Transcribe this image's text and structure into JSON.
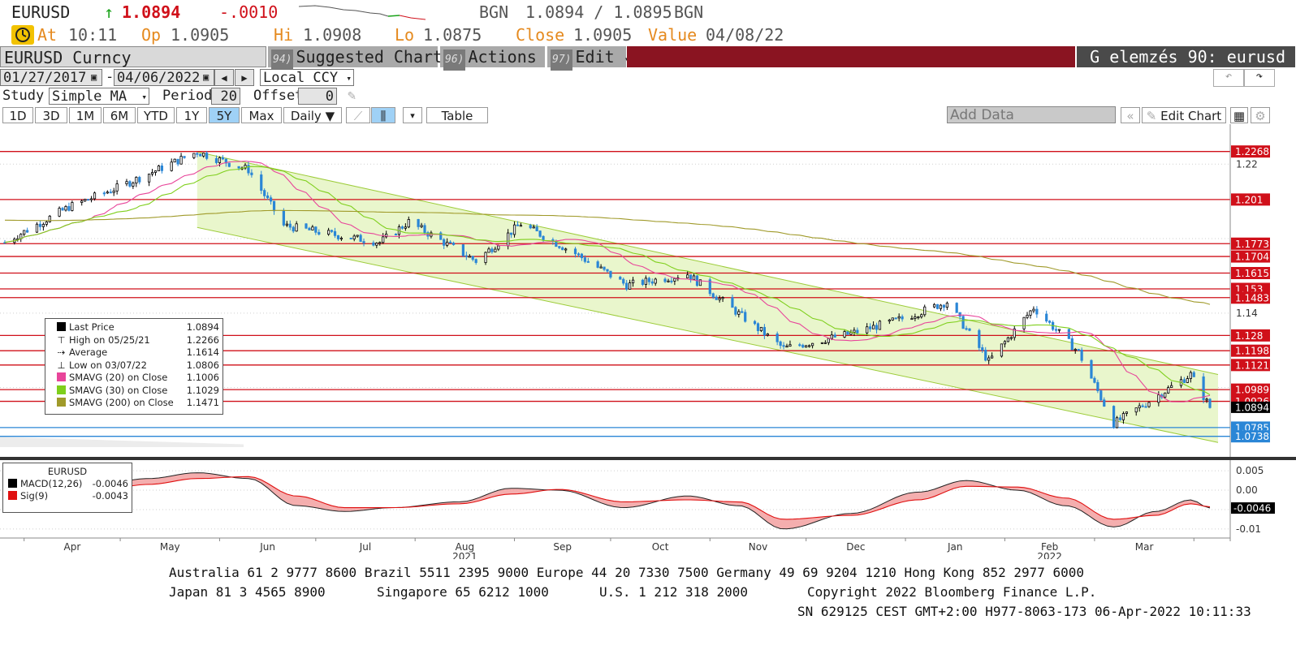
{
  "quote": {
    "ticker": "EURUSD",
    "last": "1.0894",
    "change": "-.0010",
    "source_left": "BGN",
    "bid_ask": "1.0894 / 1.0895",
    "source_right": "BGN",
    "at_label": "At",
    "at_time": "10:11",
    "open_label": "Op",
    "open": "1.0905",
    "high_label": "Hi",
    "high": "1.0908",
    "low_label": "Lo",
    "low": "1.0875",
    "close_label": "Close",
    "close": "1.0905",
    "value_label": "Value",
    "value_date": "04/08/22"
  },
  "menubar": {
    "security": "EURUSD Curncy",
    "suggested_num": "94)",
    "suggested": "Suggested Charts",
    "actions_num": "96)",
    "actions": "Actions",
    "edit_num": "97)",
    "edit": "Edit",
    "function_title": "G elemzés 90: eurusd"
  },
  "controls": {
    "date_from": "01/27/2017",
    "date_sep": "-",
    "date_to": "04/06/2022",
    "currency": "Local CCY",
    "study_label": "Study",
    "study": "Simple MA",
    "period_label": "Period",
    "period": "20",
    "offset_label": "Offset",
    "offset": "0"
  },
  "tabs": [
    "1D",
    "3D",
    "1M",
    "6M",
    "YTD",
    "1Y",
    "5Y",
    "Max"
  ],
  "selected_tab": "5Y",
  "frequency": "Daily",
  "table_label": "Table",
  "add_data_placeholder": "Add Data",
  "edit_chart": "Edit Chart",
  "legend": {
    "rows": [
      {
        "label": "Last Price",
        "value": "1.0894",
        "color": "#000000"
      },
      {
        "label": "High on 05/25/21",
        "value": "1.2266",
        "color": ""
      },
      {
        "label": "Average",
        "value": "1.1614",
        "color": ""
      },
      {
        "label": "Low on 03/07/22",
        "value": "1.0806",
        "color": ""
      },
      {
        "label": "SMAVG (20)  on Close",
        "value": "1.1006",
        "color": "#e8459a"
      },
      {
        "label": "SMAVG (30)  on Close",
        "value": "1.1029",
        "color": "#7fcf1c"
      },
      {
        "label": "SMAVG (200)  on Close",
        "value": "1.1471",
        "color": "#a09a2a"
      }
    ]
  },
  "macd_legend": {
    "title": "EURUSD",
    "rows": [
      {
        "label": "MACD(12,26)",
        "value": "-0.0046",
        "color": "#000000"
      },
      {
        "label": "Sig(9)",
        "value": "-0.0043",
        "color": "#e01010"
      }
    ]
  },
  "chart_data": [
    {
      "type": "candlestick",
      "title": "EURUSD Curncy",
      "ylim": [
        1.068,
        1.238
      ],
      "yticks": [
        "1.22",
        "1.14"
      ],
      "x_months": [
        "Apr",
        "May",
        "Jun",
        "Jul",
        "Aug",
        "Sep",
        "Oct",
        "Nov",
        "Dec",
        "Jan",
        "Feb",
        "Mar"
      ],
      "year_labels": [
        "2021",
        "2022"
      ],
      "approx_close_path": [
        {
          "date": "2021-03-26",
          "close": 1.178
        },
        {
          "date": "2021-04-15",
          "close": 1.197
        },
        {
          "date": "2021-05-01",
          "close": 1.208
        },
        {
          "date": "2021-05-25",
          "close": 1.2266
        },
        {
          "date": "2021-06-10",
          "close": 1.217
        },
        {
          "date": "2021-06-21",
          "close": 1.187
        },
        {
          "date": "2021-07-07",
          "close": 1.182
        },
        {
          "date": "2021-07-21",
          "close": 1.178
        },
        {
          "date": "2021-07-30",
          "close": 1.189
        },
        {
          "date": "2021-08-20",
          "close": 1.168
        },
        {
          "date": "2021-09-03",
          "close": 1.188
        },
        {
          "date": "2021-09-20",
          "close": 1.172
        },
        {
          "date": "2021-10-06",
          "close": 1.155
        },
        {
          "date": "2021-10-25",
          "close": 1.161
        },
        {
          "date": "2021-11-24",
          "close": 1.121
        },
        {
          "date": "2021-12-15",
          "close": 1.129
        },
        {
          "date": "2021-12-31",
          "close": 1.137
        },
        {
          "date": "2022-01-14",
          "close": 1.146
        },
        {
          "date": "2022-01-27",
          "close": 1.114
        },
        {
          "date": "2022-02-10",
          "close": 1.143
        },
        {
          "date": "2022-02-24",
          "close": 1.119
        },
        {
          "date": "2022-03-07",
          "close": 1.0806
        },
        {
          "date": "2022-03-31",
          "close": 1.107
        },
        {
          "date": "2022-04-06",
          "close": 1.0894
        }
      ],
      "horizontal_levels": [
        {
          "label": "1.2268",
          "value": 1.2268,
          "color": "#d0101a"
        },
        {
          "label": "1.201",
          "value": 1.201,
          "color": "#d0101a"
        },
        {
          "label": "1.1773",
          "value": 1.1773,
          "color": "#d0101a"
        },
        {
          "label": "1.1704",
          "value": 1.1704,
          "color": "#d0101a"
        },
        {
          "label": "1.1615",
          "value": 1.1615,
          "color": "#d0101a"
        },
        {
          "label": "1.153",
          "value": 1.153,
          "color": "#d0101a"
        },
        {
          "label": "1.1483",
          "value": 1.1483,
          "color": "#d0101a"
        },
        {
          "label": "1.128",
          "value": 1.128,
          "color": "#d0101a"
        },
        {
          "label": "1.1198",
          "value": 1.1198,
          "color": "#d0101a"
        },
        {
          "label": "1.1121",
          "value": 1.1121,
          "color": "#d0101a"
        },
        {
          "label": "1.0989",
          "value": 1.0989,
          "color": "#d0101a"
        },
        {
          "label": "1.0926",
          "value": 1.0926,
          "color": "#d0101a"
        },
        {
          "label": "1.0785",
          "value": 1.0785,
          "color": "#2a86d6"
        },
        {
          "label": "1.0738",
          "value": 1.0738,
          "color": "#2a86d6"
        }
      ],
      "last_price_tag": "1.0894",
      "colors": {
        "up": "#000000",
        "down": "#2a86d6",
        "channel": "#e9f6cc",
        "sma20": "#e8459a",
        "sma30": "#7fcf1c",
        "sma200": "#a09a2a",
        "level": "#d0101a"
      }
    },
    {
      "type": "line",
      "title": "EURUSD",
      "ylim": [
        -0.0115,
        0.0065
      ],
      "yticks": [
        "0.005",
        "0.00",
        "-0.005",
        "-0.01"
      ],
      "last_tag": "-0.0046",
      "series": [
        {
          "name": "MACD(12,26)",
          "points": [
            {
              "date": "2021-03-26",
              "y": -0.0055
            },
            {
              "date": "2021-04-15",
              "y": -0.0005
            },
            {
              "date": "2021-05-10",
              "y": 0.003
            },
            {
              "date": "2021-05-25",
              "y": 0.0045
            },
            {
              "date": "2021-06-10",
              "y": 0.003
            },
            {
              "date": "2021-06-25",
              "y": -0.004
            },
            {
              "date": "2021-07-10",
              "y": -0.0055
            },
            {
              "date": "2021-07-25",
              "y": -0.0045
            },
            {
              "date": "2021-08-15",
              "y": -0.003
            },
            {
              "date": "2021-08-31",
              "y": 0.0005
            },
            {
              "date": "2021-09-15",
              "y": 0.0
            },
            {
              "date": "2021-10-05",
              "y": -0.0045
            },
            {
              "date": "2021-10-25",
              "y": -0.0015
            },
            {
              "date": "2021-11-10",
              "y": -0.004
            },
            {
              "date": "2021-11-24",
              "y": -0.01
            },
            {
              "date": "2021-12-15",
              "y": -0.006
            },
            {
              "date": "2022-01-05",
              "y": -0.0005
            },
            {
              "date": "2022-01-20",
              "y": 0.0025
            },
            {
              "date": "2022-02-05",
              "y": 0.0
            },
            {
              "date": "2022-02-20",
              "y": -0.004
            },
            {
              "date": "2022-03-07",
              "y": -0.0095
            },
            {
              "date": "2022-03-20",
              "y": -0.0055
            },
            {
              "date": "2022-03-31",
              "y": -0.0025
            },
            {
              "date": "2022-04-06",
              "y": -0.0046
            }
          ]
        },
        {
          "name": "Sig(9)",
          "points": [
            {
              "date": "2021-03-26",
              "y": -0.004
            },
            {
              "date": "2021-04-15",
              "y": -0.002
            },
            {
              "date": "2021-05-10",
              "y": 0.0015
            },
            {
              "date": "2021-05-25",
              "y": 0.003
            },
            {
              "date": "2021-06-10",
              "y": 0.0035
            },
            {
              "date": "2021-06-25",
              "y": -0.0015
            },
            {
              "date": "2021-07-10",
              "y": -0.0045
            },
            {
              "date": "2021-07-25",
              "y": -0.0045
            },
            {
              "date": "2021-08-15",
              "y": -0.0035
            },
            {
              "date": "2021-08-31",
              "y": -0.001
            },
            {
              "date": "2021-09-15",
              "y": 0.0002
            },
            {
              "date": "2021-10-05",
              "y": -0.003
            },
            {
              "date": "2021-10-25",
              "y": -0.0025
            },
            {
              "date": "2021-11-10",
              "y": -0.003
            },
            {
              "date": "2021-11-24",
              "y": -0.0075
            },
            {
              "date": "2021-12-15",
              "y": -0.0065
            },
            {
              "date": "2022-01-05",
              "y": -0.0025
            },
            {
              "date": "2022-01-20",
              "y": 0.001
            },
            {
              "date": "2022-02-05",
              "y": 0.0008
            },
            {
              "date": "2022-02-20",
              "y": -0.002
            },
            {
              "date": "2022-03-07",
              "y": -0.0075
            },
            {
              "date": "2022-03-20",
              "y": -0.0065
            },
            {
              "date": "2022-03-31",
              "y": -0.0035
            },
            {
              "date": "2022-04-06",
              "y": -0.0043
            }
          ]
        }
      ]
    }
  ],
  "footer": {
    "line1": "Australia 61 2 9777 8600 Brazil 5511 2395 9000 Europe 44 20 7330 7500 Germany 49 69 9204 1210 Hong Kong 852 2977 6000",
    "line2_a": "Japan 81 3 4565 8900",
    "line2_b": "Singapore 65 6212 1000",
    "line2_c": "U.S. 1 212 318 2000",
    "line2_d": "Copyright 2022 Bloomberg Finance L.P.",
    "line3": "SN 629125 CEST GMT+2:00 H977-8063-173 06-Apr-2022 10:11:33"
  }
}
